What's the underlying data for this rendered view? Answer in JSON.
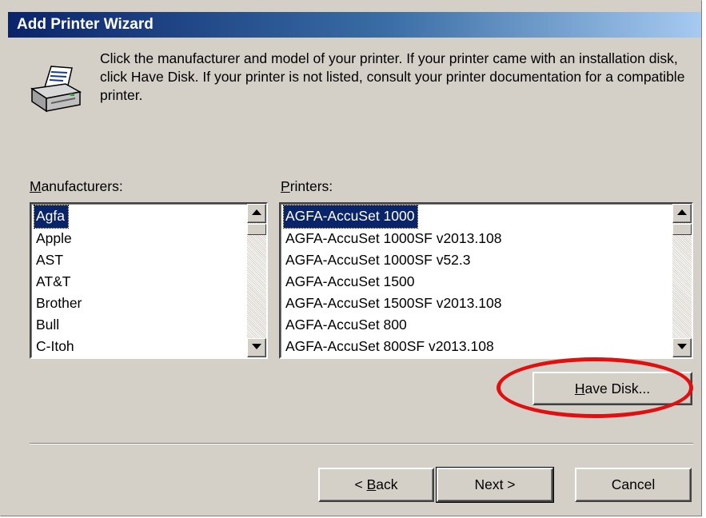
{
  "window": {
    "title": "Add Printer Wizard"
  },
  "instructions": "Click the manufacturer and model of your printer. If your printer came with an installation disk, click Have Disk. If your printer is not listed, consult your printer documentation for a compatible printer.",
  "manufacturers": {
    "label_key": "M",
    "label_rest": "anufacturers:",
    "items": [
      "Agfa",
      "Apple",
      "AST",
      "AT&T",
      "Brother",
      "Bull",
      "C-Itoh"
    ],
    "selected": "Agfa"
  },
  "printers": {
    "label_key": "P",
    "label_rest": "rinters:",
    "items": [
      "AGFA-AccuSet 1000",
      "AGFA-AccuSet 1000SF v2013.108",
      "AGFA-AccuSet 1000SF v52.3",
      "AGFA-AccuSet 1500",
      "AGFA-AccuSet 1500SF v2013.108",
      "AGFA-AccuSet 800",
      "AGFA-AccuSet 800SF v2013.108"
    ],
    "selected": "AGFA-AccuSet 1000"
  },
  "buttons": {
    "have_disk_key": "H",
    "have_disk_rest": "ave Disk...",
    "back_prefix": "< ",
    "back_key": "B",
    "back_rest": "ack",
    "next": "Next >",
    "cancel": "Cancel"
  },
  "annotation": {
    "highlight_color": "#e01010",
    "target": "Have Disk..."
  },
  "colors": {
    "titlebar_start": "#0a246a",
    "titlebar_end": "#a6caf0",
    "dialog_bg": "#d4d0c8",
    "selection": "#0a246a"
  },
  "icons": [
    "printer-icon",
    "scroll-up-arrow-icon",
    "scroll-down-arrow-icon"
  ]
}
